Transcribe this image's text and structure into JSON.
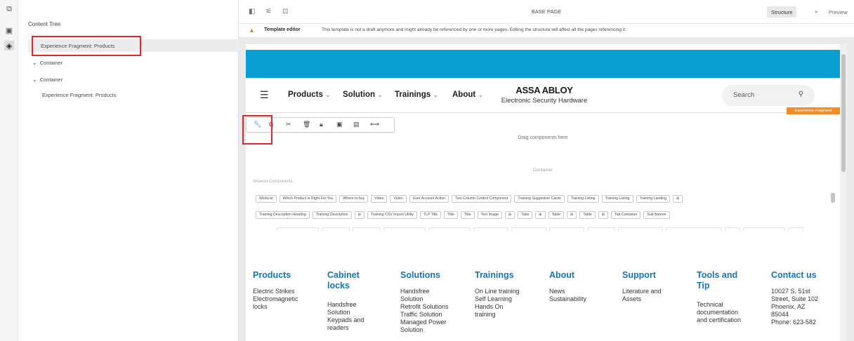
{
  "left_rail": {
    "icons": [
      "components-icon",
      "assets-icon",
      "layers-icon"
    ]
  },
  "content_tree": {
    "title": "Content Tree",
    "items": [
      {
        "label": "Experience Fragment: Products"
      },
      {
        "label": "Container"
      },
      {
        "label": "Container"
      },
      {
        "label": "Experience Fragment: Products"
      }
    ]
  },
  "topbar": {
    "page_title": "BASE PAGE",
    "mode_structure": "Structure",
    "mode_preview": "Preview"
  },
  "warning": {
    "title": "Template editor",
    "message": "This template is not a draft anymore and might already be referenced by one or more pages. Editing the structure will affect all the pages referencing it."
  },
  "site_header": {
    "nav": [
      {
        "label": "Products"
      },
      {
        "label": "Solution"
      },
      {
        "label": "Trainings"
      },
      {
        "label": "About"
      }
    ],
    "brand": "ASSA ABLOY",
    "brand_sub": "Electronic Security Hardware",
    "search_placeholder": "Search"
  },
  "fragment_tag": "Experience Fragment",
  "editor": {
    "drag_hint": "Drag components here",
    "container_label": "Container",
    "allowed_label": "Allowed Components"
  },
  "allowed_components": {
    "row1": [
      "WishList",
      "Which Product is Right For You",
      "Where to buy",
      "Video",
      "Video",
      "User Account Action",
      "Two Column Control Component",
      "Training Suggestion Cards",
      "Training Listing",
      "Training Listing",
      "Training Landing",
      "⊞"
    ],
    "row2": [
      "Training Description Heading",
      "Training Description",
      "⊞",
      "Training CSV Import Utility",
      "TLP Title",
      "Title",
      "Title",
      "Text Image",
      "⊞",
      "Tabs",
      "⊞",
      "Table",
      "⊞",
      "Table",
      "⊞",
      "Tab Container",
      "Sub Banner"
    ]
  },
  "footer": {
    "columns": [
      {
        "heading": "Products",
        "lines": [
          "Electric Strikes",
          "Electromagnetic",
          "locks"
        ]
      },
      {
        "heading": "Cabinet locks",
        "lines": [
          "Handsfree",
          "Solution",
          "Keypads and",
          "readers"
        ]
      },
      {
        "heading": "Solutions",
        "lines": [
          "Handsfree",
          "Solution",
          "Retrofit Solutions",
          "Traffic Solution",
          "Managed Power",
          "Solution"
        ]
      },
      {
        "heading": "Trainings",
        "lines": [
          "On Line training",
          "Self Learning",
          "Hands On",
          "training"
        ]
      },
      {
        "heading": "About",
        "lines": [
          "News",
          "Sustainability"
        ]
      },
      {
        "heading": "Support",
        "lines": [
          "Literature and",
          "Assets"
        ]
      },
      {
        "heading": "Tools and Tip",
        "lines": [
          "Technical",
          "documentation",
          "and certification"
        ]
      },
      {
        "heading": "Contact us",
        "lines": [
          "10027 S. 51st",
          "Street, Suite 102",
          "Phoenix, AZ",
          "85044",
          "Phone: 623-582"
        ]
      }
    ]
  },
  "highlight_color": "#e3262a",
  "accent_color": "#0a9fd2"
}
